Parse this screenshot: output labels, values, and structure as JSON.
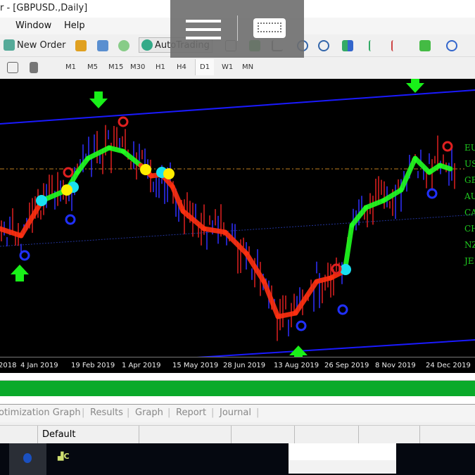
{
  "window": {
    "title": "r - [GBPUSD.,Daily]"
  },
  "menu": {
    "items": [
      "Window",
      "Help"
    ]
  },
  "toolbar": {
    "new_order": "New Order",
    "autotrading": "AutoTrading"
  },
  "timeframes": [
    "M1",
    "M5",
    "M15",
    "M30",
    "H1",
    "H4",
    "D1",
    "W1",
    "MN"
  ],
  "active_timeframe": "D1",
  "chart": {
    "symbol": "GBPUSD.",
    "period": "Daily",
    "x_labels": [
      "2018",
      "4 Jan 2019",
      "19 Feb 2019",
      "1 Apr 2019",
      "15 May 2019",
      "28 Jun 2019",
      "13 Aug 2019",
      "26 Sep 2019",
      "8 Nov 2019",
      "24 Dec 2019"
    ],
    "currency_labels": [
      "EU",
      "US",
      "GB",
      "AU",
      "CA",
      "CH",
      "NZ",
      "JE"
    ],
    "colors": {
      "up": "#20ff20",
      "down": "#ff3010",
      "channel": "#1a1aff",
      "signal_cyan": "#19e0f0",
      "signal_yellow": "#ffee00"
    }
  },
  "progress": {
    "percent": 100,
    "color": "#0aaa2a"
  },
  "tabs": [
    "otimization Graph",
    "Results",
    "Graph",
    "Report",
    "Journal"
  ],
  "status": {
    "profile": "Default"
  }
}
